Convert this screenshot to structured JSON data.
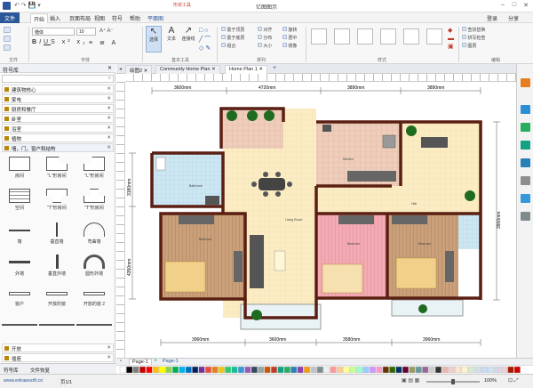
{
  "app": {
    "title": "亿图图示",
    "context_tab": "形状工具"
  },
  "menu": {
    "file": "文件",
    "items": [
      "开始",
      "插入",
      "页面布局",
      "视图",
      "符号",
      "帮助",
      "平面图"
    ],
    "right": [
      "登录",
      "分享"
    ]
  },
  "ribbon": {
    "font_name": "楷体",
    "font_size": "10",
    "groups": [
      "文件",
      "字体",
      "基本工具",
      "排列",
      "样式",
      "编辑"
    ],
    "tools": [
      {
        "label": "选择"
      },
      {
        "label": "文本"
      },
      {
        "label": "连接线"
      }
    ],
    "arrange": [
      "置于顶层",
      "置于底层",
      "组合",
      "对齐",
      "分布",
      "大小",
      "旋转",
      "居中",
      "镜像",
      "保护"
    ],
    "edit": [
      "查找替换",
      "拼写检查",
      "图层"
    ]
  },
  "left_panel": {
    "title": "符号库",
    "libraries": [
      "建筑物核心",
      "家电",
      "厨房和餐厅",
      "卧室",
      "浴室",
      "植物",
      "墙，门，窗户和结构"
    ],
    "shapes": [
      "房间",
      "\"L\"形房间",
      "\"L\"形房间",
      "空间",
      "\"T\"形房间",
      "\"T\"形房间",
      "墙",
      "垂直墙",
      "弯曲墙",
      "外墙",
      "垂直外墙",
      "圆形外墙",
      "窗户",
      "开放的窗",
      "开放的窗 2"
    ],
    "bottom": [
      "开放",
      "插座"
    ],
    "tabs": [
      "符号库",
      "文件恢复"
    ]
  },
  "tabs": [
    {
      "label": "绘图2"
    },
    {
      "label": "Community Home Plan"
    },
    {
      "label": "Home Plan 1"
    }
  ],
  "floorplan": {
    "dims_top": [
      "3600mm",
      "4720mm",
      "3890mm",
      "3890mm"
    ],
    "dims_bottom": [
      "3960mm",
      "3600mm",
      "3580mm",
      "3960mm"
    ],
    "dims_left": [
      "3180mm",
      "4350mm"
    ],
    "dims_right": [
      "3900mm"
    ],
    "rooms": [
      "Bathroom",
      "Living Room",
      "Kitchen",
      "Hall",
      "Bedroom",
      "Bedroom",
      "Bedroom"
    ]
  },
  "pagebar": {
    "page": "Page-1",
    "add": "+",
    "page2": "Page-1"
  },
  "status": {
    "url": "www.edrawsoft.cn",
    "page": "页1/1",
    "zoom": "100%"
  },
  "colors": [
    "#ffffff",
    "#000000",
    "#7f7f7f",
    "#c00000",
    "#ff0000",
    "#ffc000",
    "#ffff00",
    "#92d050",
    "#00b050",
    "#00b0f0",
    "#0070c0",
    "#002060",
    "#7030a0",
    "#e74c3c",
    "#e67e22",
    "#f1c40f",
    "#2ecc71",
    "#1abc9c",
    "#3498db",
    "#9b59b6",
    "#34495e",
    "#95a5a6",
    "#d35400",
    "#c0392b",
    "#16a085",
    "#27ae60",
    "#2980b9",
    "#8e44ad",
    "#f39c12",
    "#bdc3c7",
    "#7f8c8d",
    "#ecf0f1",
    "#ff9999",
    "#ffcc99",
    "#ffff99",
    "#ccff99",
    "#99ffcc",
    "#99ccff",
    "#cc99ff",
    "#ff99cc",
    "#663300",
    "#336600",
    "#003366",
    "#660033",
    "#999966",
    "#669999",
    "#996699",
    "#cccccc",
    "#333333",
    "#e6b8af",
    "#f4cccc",
    "#fce5cd",
    "#fff2cc",
    "#d9ead3",
    "#d0e0e3",
    "#c9daf8",
    "#cfe2f3",
    "#d9d2e9",
    "#ead1dc",
    "#a61c00",
    "#cc0000"
  ]
}
